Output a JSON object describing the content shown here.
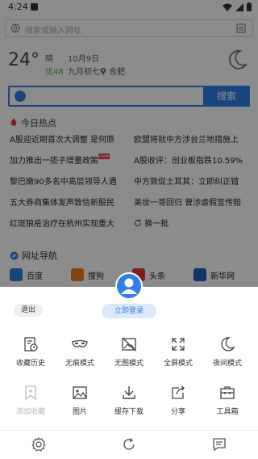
{
  "status_bar": {
    "time": "4:24"
  },
  "url_bar": {
    "placeholder": "搜索或输入网址"
  },
  "weather": {
    "temperature": "24°",
    "condition": "晴",
    "date": "10月9日",
    "air_quality": "优48",
    "lunar_date": "九月初七",
    "location": "合肥"
  },
  "search": {
    "button_label": "搜索"
  },
  "hot_news": {
    "title": "今日热点",
    "items": [
      "A股迎近期首次大调整 是何原",
      "欧盟将就中方涉台兰地措施上",
      "加力推出一揽子增量政策",
      "A股收评：创业板指跌10.59%",
      "黎巴嫩90多名中高层领导人遇",
      "中方敦促土耳其：立即纠正错",
      "五大券商集体发声致信新股民",
      "美妆一哥回归 曾涉虐假宣传赔",
      "红斑狼疮治疗在杭州实现重大"
    ],
    "new_badge": "new",
    "refresh_label": "换一批"
  },
  "site_nav": {
    "title": "网址导航",
    "items": [
      {
        "label": "百度"
      },
      {
        "label": "搜狗"
      },
      {
        "label": "头条"
      },
      {
        "label": "新华网"
      }
    ]
  },
  "menu": {
    "logout_label": "退出",
    "login_label": "立即登录",
    "items": [
      {
        "label": "收藏历史",
        "icon": "bookmark-history-icon",
        "enabled": true
      },
      {
        "label": "无痕模式",
        "icon": "incognito-mask-icon",
        "enabled": true
      },
      {
        "label": "无图模式",
        "icon": "no-image-icon",
        "enabled": true
      },
      {
        "label": "全屏模式",
        "icon": "fullscreen-icon",
        "enabled": true
      },
      {
        "label": "夜间模式",
        "icon": "night-moon-icon",
        "enabled": true
      },
      {
        "label": "添加收藏",
        "icon": "add-bookmark-icon",
        "enabled": false
      },
      {
        "label": "图片",
        "icon": "image-icon",
        "enabled": true
      },
      {
        "label": "缓存下载",
        "icon": "download-icon",
        "enabled": true
      },
      {
        "label": "分享",
        "icon": "share-icon",
        "enabled": true
      },
      {
        "label": "工具箱",
        "icon": "toolbox-icon",
        "enabled": true
      }
    ]
  },
  "bottom_bar": {
    "icons": [
      "settings-gear-icon",
      "refresh-icon",
      "feedback-icon"
    ]
  },
  "colors": {
    "accent": "#2f7fe6",
    "aqi_green": "#3fae3f",
    "hot_red": "#e53935"
  }
}
